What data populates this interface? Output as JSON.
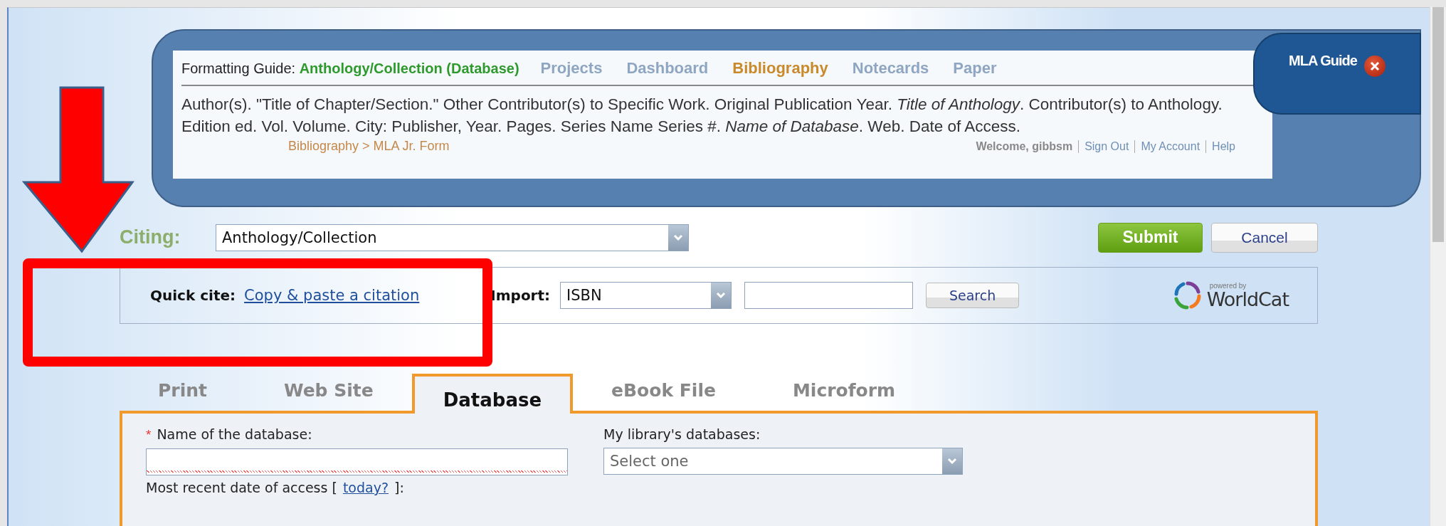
{
  "header": {
    "nav": [
      "Projects",
      "Dashboard",
      "Bibliography",
      "Notecards",
      "Paper"
    ],
    "location": "Bibliography > MLA Jr. Form",
    "welcome": "Welcome, gibbsm",
    "user_links": [
      "Sign Out",
      "My Account",
      "Help"
    ],
    "guide": {
      "heading_label": "Formatting Guide:",
      "heading_value": "Anthology/Collection (Database)",
      "template": "Author(s). \"Title of Chapter/Section.\" Other Contributor(s) to Specific Work. Original Publication Year. *Title of Anthology*. Contributor(s) to Anthology. Edition ed. Vol. Volume. City: Publisher, Year. Pages. Series Name Series #. *Name of Database*. Web. Date of Access."
    },
    "guide_tab": {
      "label": "MLA Guide"
    }
  },
  "citing": {
    "label": "Citing:",
    "value": "Anthology/Collection"
  },
  "actions": [
    {
      "label": "Submit",
      "kind": "primary"
    },
    {
      "label": "Cancel",
      "kind": "secondary"
    }
  ],
  "quick_cite": {
    "label": "Quick cite:",
    "link": "Copy & paste a citation"
  },
  "import": {
    "label": "Import:",
    "type": "ISBN",
    "button": "Search",
    "logo_caption": "powered by",
    "logo_text": "WorldCat"
  },
  "tabs": [
    {
      "label": "Print",
      "selected": false
    },
    {
      "label": "Web Site",
      "selected": false
    },
    {
      "label": "Database",
      "selected": true
    },
    {
      "label": "eBook File",
      "selected": false
    },
    {
      "label": "Microform",
      "selected": false
    }
  ],
  "form": {
    "name_field": {
      "required_mark": "*",
      "label": "Name of the database:"
    },
    "library_field": {
      "label": "My library's databases:",
      "placeholder": "Select one"
    },
    "date_field": {
      "label_before": "Most recent date of access [",
      "link": "today?",
      "label_after": "]:"
    }
  }
}
